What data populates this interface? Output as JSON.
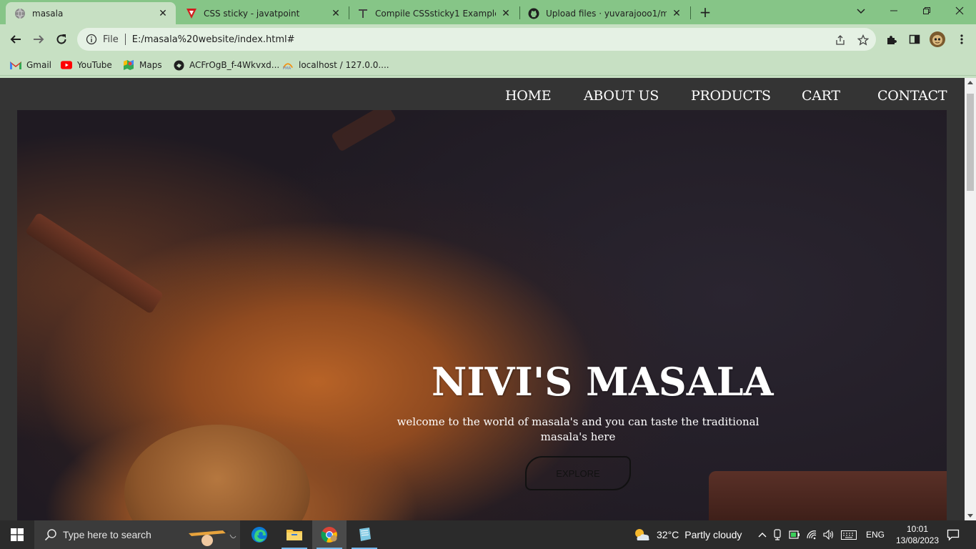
{
  "browser": {
    "tabs": [
      {
        "title": "masala",
        "icon": "globe-icon"
      },
      {
        "title": "CSS sticky - javatpoint",
        "icon": "javatpoint-icon"
      },
      {
        "title": "Compile CSSsticky1 Example: Edi",
        "icon": "tutorialspoint-icon"
      },
      {
        "title": "Upload files · yuvarajooo1/masal",
        "icon": "github-icon"
      }
    ],
    "address": {
      "scheme": "File",
      "url": "E:/masala%20website/index.html#"
    },
    "bookmarks": [
      {
        "label": "Gmail",
        "icon": "gmail-icon"
      },
      {
        "label": "YouTube",
        "icon": "youtube-icon"
      },
      {
        "label": "Maps",
        "icon": "maps-icon"
      },
      {
        "label": "ACFrOgB_f-4Wkvxd...",
        "icon": "link-icon"
      },
      {
        "label": "localhost / 127.0.0....",
        "icon": "phpmyadmin-icon"
      }
    ]
  },
  "page": {
    "nav": [
      "HOME",
      "ABOUT US",
      "PRODUCTS",
      "CART",
      "CONTACT"
    ],
    "hero": {
      "title": "NIVI'S MASALA",
      "subtitle": "welcome to the world of masala's and you can taste the traditional masala's here",
      "button": "EXPLORE"
    }
  },
  "taskbar": {
    "search_placeholder": "Type here to search",
    "weather": {
      "temp": "32°C",
      "condition": "Partly cloudy"
    },
    "language": "ENG",
    "time": "10:01",
    "date": "13/08/2023"
  },
  "colors": {
    "tabstrip": "#86c587",
    "toolbar": "#c7e0c3",
    "navbar": "#343434",
    "taskbar": "#2b2b2b"
  }
}
